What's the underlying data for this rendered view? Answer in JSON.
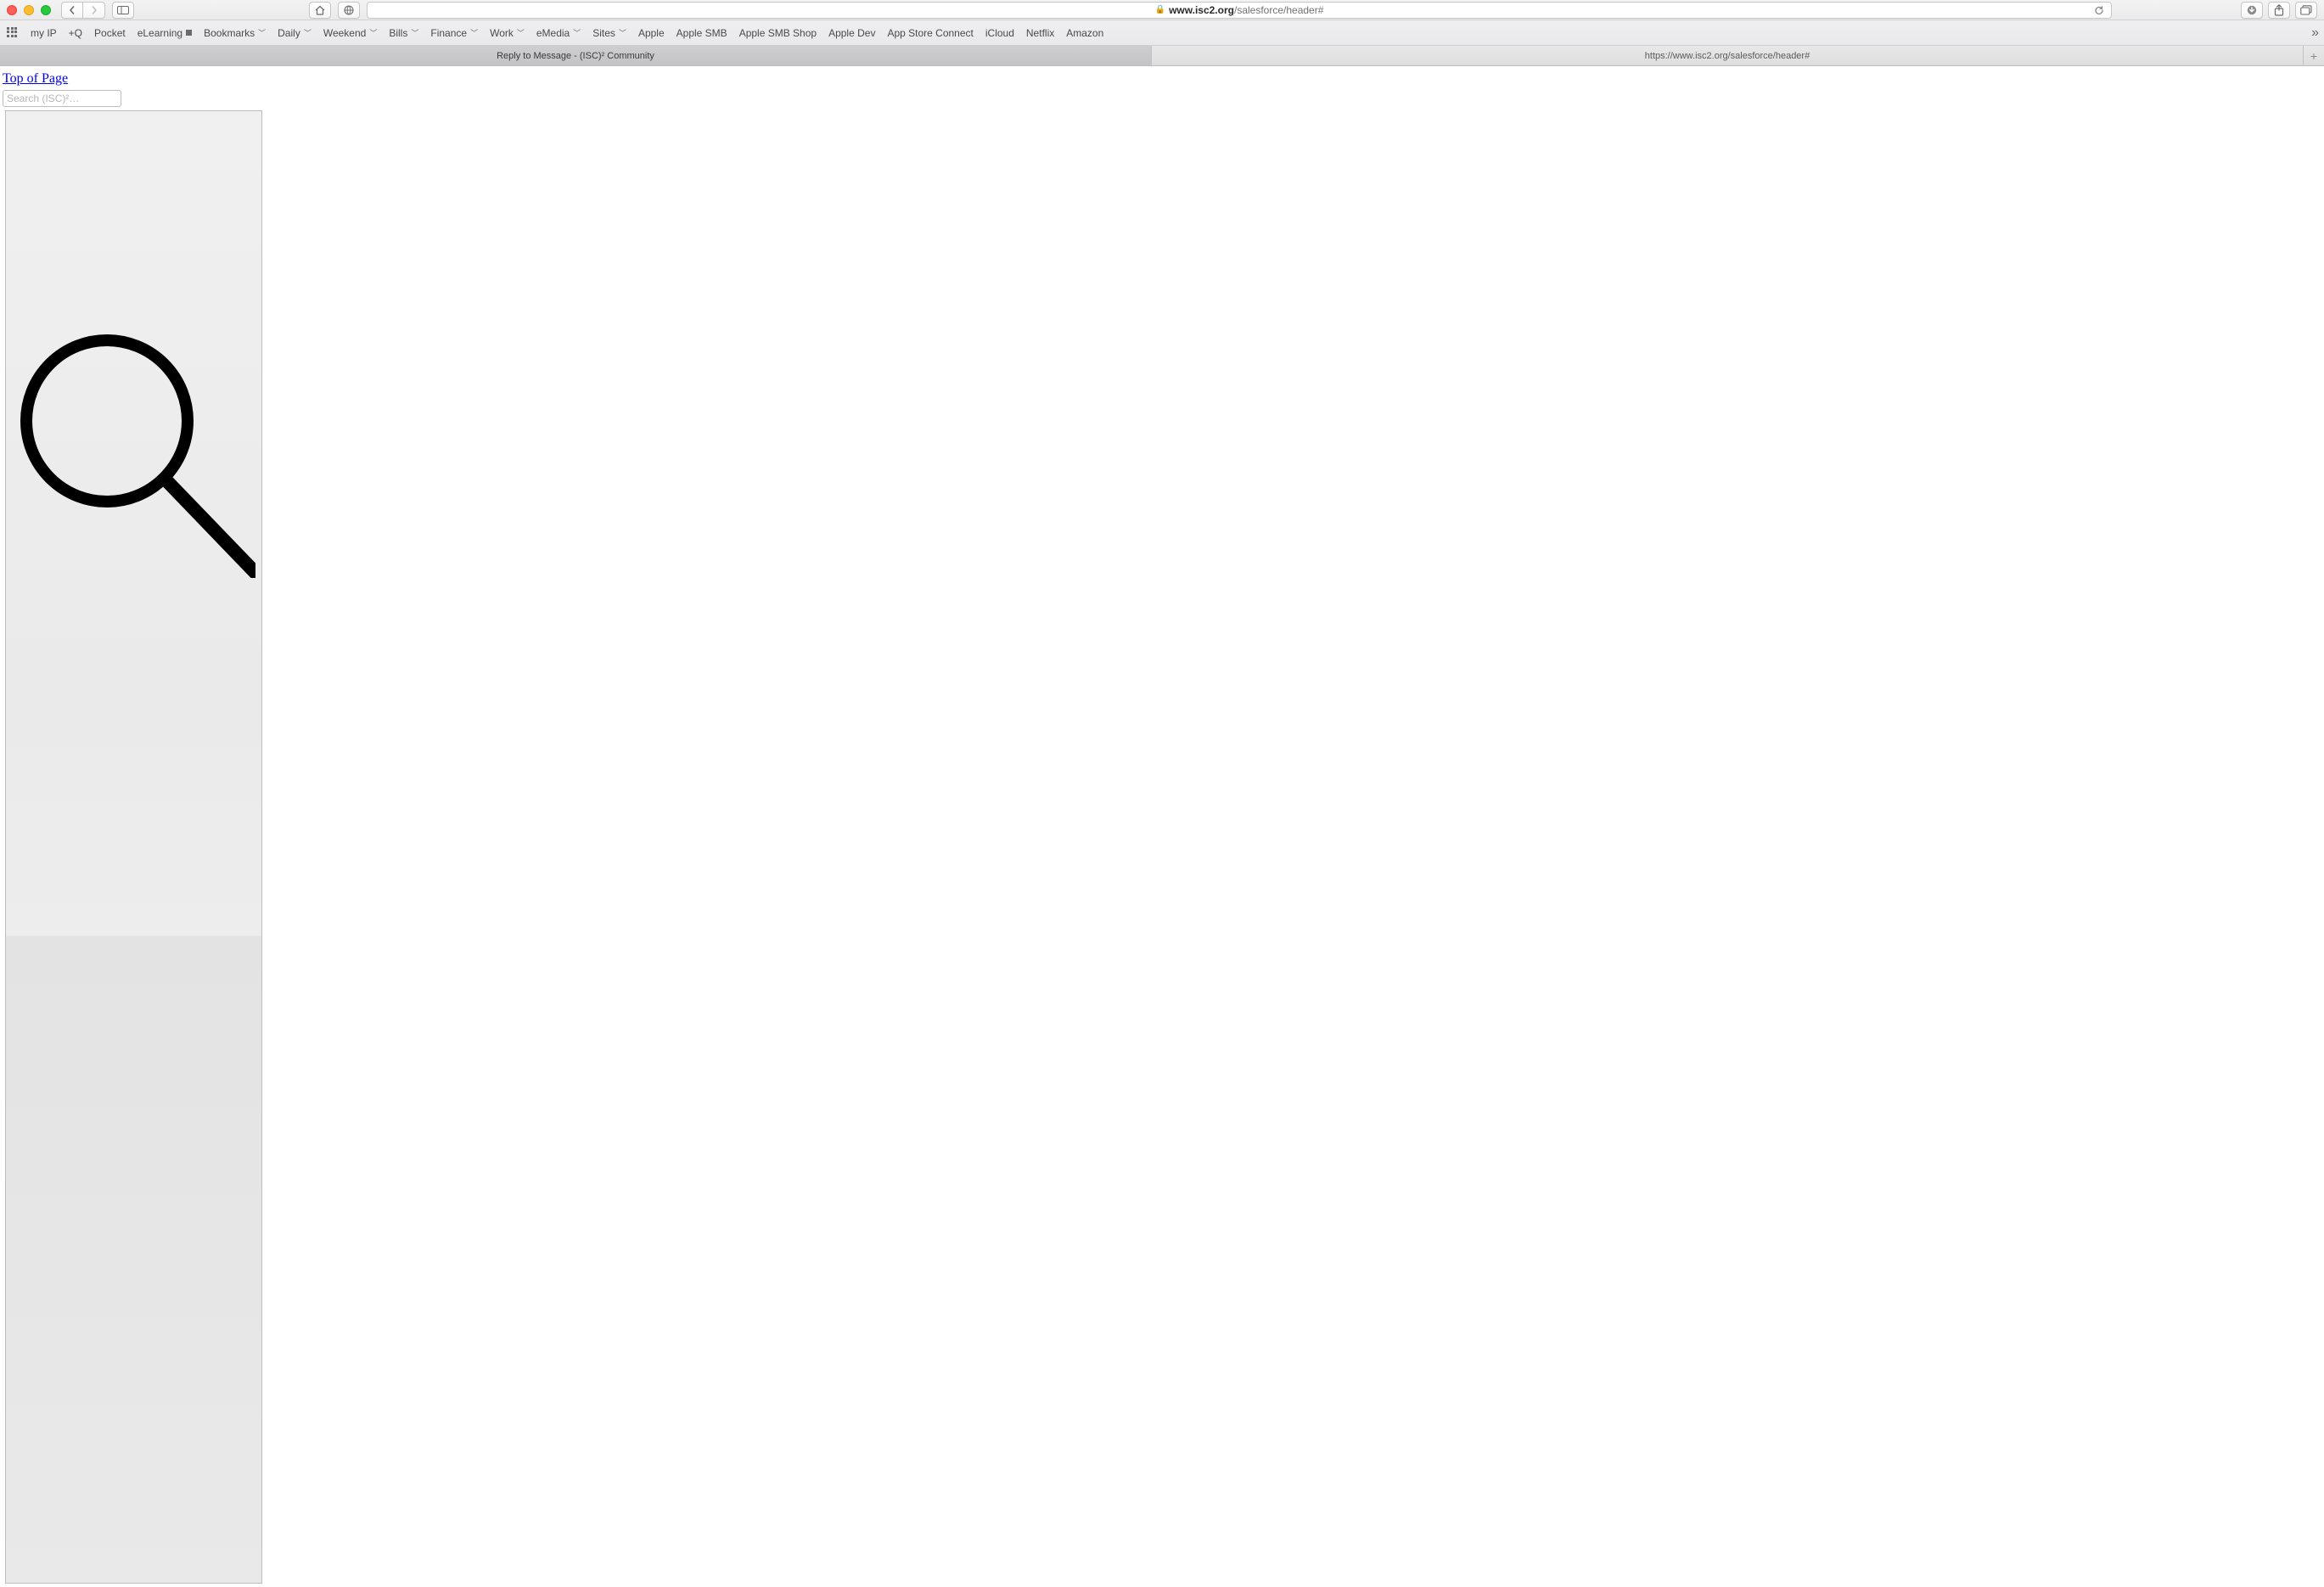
{
  "address": {
    "lock": "🔒",
    "host": "www.isc2.org",
    "path": "/salesforce/header#"
  },
  "favorites": [
    {
      "label": "my IP",
      "dropdown": false
    },
    {
      "label": "+Q",
      "dropdown": false
    },
    {
      "label": "Pocket",
      "dropdown": false
    },
    {
      "label": "eLearning",
      "dropdown": false,
      "square": true
    },
    {
      "label": "Bookmarks",
      "dropdown": true
    },
    {
      "label": "Daily",
      "dropdown": true
    },
    {
      "label": "Weekend",
      "dropdown": true
    },
    {
      "label": "Bills",
      "dropdown": true
    },
    {
      "label": "Finance",
      "dropdown": true
    },
    {
      "label": "Work",
      "dropdown": true
    },
    {
      "label": "eMedia",
      "dropdown": true
    },
    {
      "label": "Sites",
      "dropdown": true
    },
    {
      "label": "Apple",
      "dropdown": false
    },
    {
      "label": "Apple SMB",
      "dropdown": false
    },
    {
      "label": "Apple SMB Shop",
      "dropdown": false
    },
    {
      "label": "Apple Dev",
      "dropdown": false
    },
    {
      "label": "App Store Connect",
      "dropdown": false
    },
    {
      "label": "iCloud",
      "dropdown": false
    },
    {
      "label": "Netflix",
      "dropdown": false
    },
    {
      "label": "Amazon",
      "dropdown": false
    }
  ],
  "tabs": [
    {
      "title": "Reply to Message - (ISC)² Community",
      "active": true
    },
    {
      "title": "https://www.isc2.org/salesforce/header#",
      "active": false
    }
  ],
  "page": {
    "top_link": "Top of Page",
    "search_placeholder": "Search (ISC)²…"
  }
}
